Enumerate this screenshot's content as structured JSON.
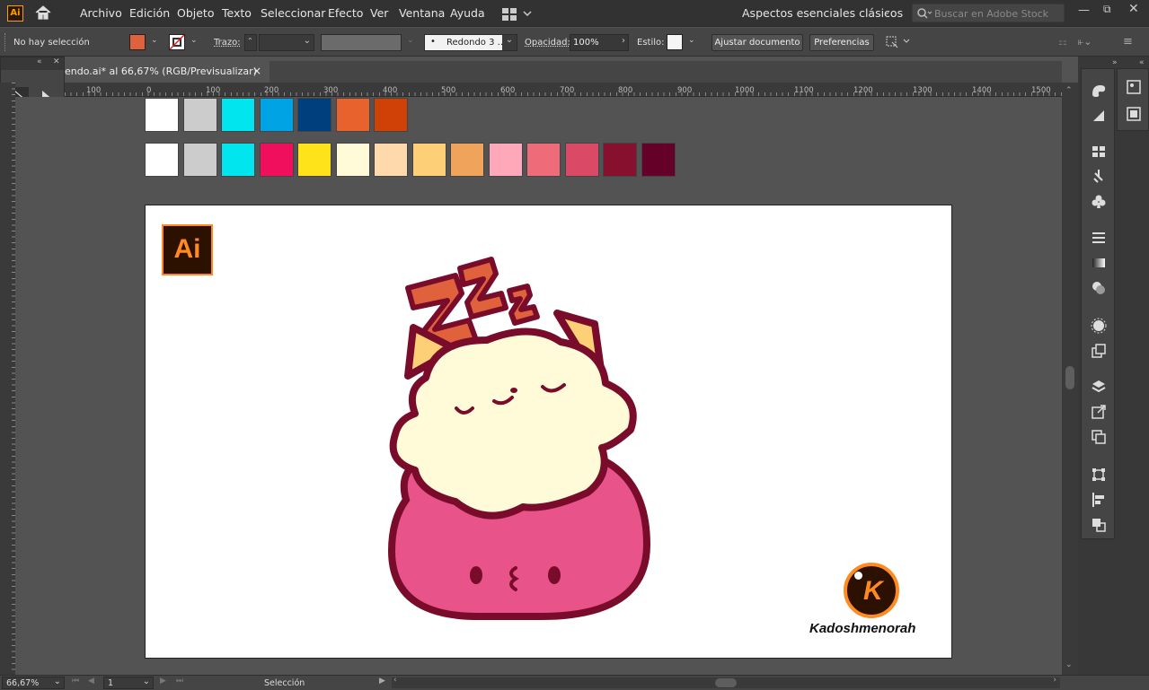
{
  "app": {
    "logo": "Ai",
    "home_icon": "home-icon"
  },
  "menu": [
    "Archivo",
    "Edición",
    "Objeto",
    "Texto",
    "Seleccionar",
    "Efecto",
    "Ver",
    "Ventana",
    "Ayuda"
  ],
  "workspace": {
    "label": "Aspectos esenciales clásicos"
  },
  "search": {
    "placeholder": "Buscar en Adobe Stock"
  },
  "control": {
    "selection": "No hay selección",
    "fill_color": "#e0623c",
    "trazo_label": "Trazo:",
    "brush": "Redondo 3 ...",
    "opacity_label": "Opacidad:",
    "opacity_value": "100%",
    "style_label": "Estilo:",
    "fit_button": "Ajustar documento",
    "prefs_button": "Preferencias"
  },
  "document": {
    "tab_title": "endo.ai* al 66,67% (RGB/Previsualizar)",
    "close": "×"
  },
  "ruler": {
    "ticks": [
      "100",
      "0",
      "100",
      "200",
      "300",
      "400",
      "500",
      "600",
      "700",
      "800",
      "900",
      "1000",
      "1100",
      "1200",
      "1300",
      "1400",
      "1500"
    ]
  },
  "swatches": {
    "row1": [
      "#ffffff",
      "#cccccc",
      "#00e5ee",
      "#00a4e4",
      "#003f7d",
      "#e8622e",
      "#d04107"
    ],
    "row2": [
      "#ffffff",
      "#cccccc",
      "#00e5ee",
      "#ef0f5d",
      "#ffe31a",
      "#fffbd8",
      "#fdd9ab",
      "#fdcf77",
      "#f0a45b",
      "#ffa8b9",
      "#ee6c7a",
      "#da4a66",
      "#88102f",
      "#650028"
    ]
  },
  "artboard": {
    "badge": "Ai",
    "watermark_letter": "K",
    "watermark_name": "Kadoshmenorah"
  },
  "status": {
    "zoom": "66,67%",
    "page": "1",
    "tool": "Selección"
  }
}
